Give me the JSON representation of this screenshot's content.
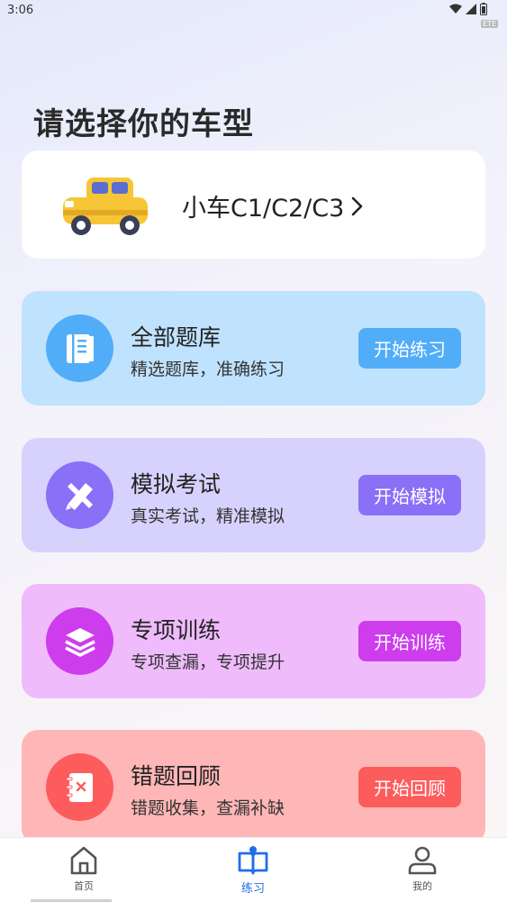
{
  "status_bar": {
    "time": "3:06",
    "tag": "ETE",
    "icons": [
      "wifi-icon",
      "signal-icon",
      "battery-icon"
    ]
  },
  "page_title": "请选择你的车型",
  "car_selector": {
    "label": "小车C1/C2/C3",
    "icon": "car-icon",
    "chevron": "chevron-right-icon"
  },
  "features": [
    {
      "title": "全部题库",
      "subtitle": "精选题库，准确练习",
      "button": "开始练习",
      "icon": "question-bank-icon",
      "card_color": "#bfe2fe",
      "accent_color": "#52adf8"
    },
    {
      "title": "模拟考试",
      "subtitle": "真实考试，精准模拟",
      "button": "开始模拟",
      "icon": "pencil-ruler-icon",
      "card_color": "#d7d2fd",
      "accent_color": "#8a6ff7"
    },
    {
      "title": "专项训练",
      "subtitle": "专项查漏，专项提升",
      "button": "开始训练",
      "icon": "layers-icon",
      "card_color": "#efbbfb",
      "accent_color": "#cd3ced"
    },
    {
      "title": "错题回顾",
      "subtitle": "错题收集，查漏补缺",
      "button": "开始回顾",
      "icon": "wrong-notebook-icon",
      "card_color": "#ffb6b6",
      "accent_color": "#fd5c5c"
    }
  ],
  "tab_bar": {
    "items": [
      {
        "label": "首页",
        "icon": "home-icon",
        "active": false
      },
      {
        "label": "练习",
        "icon": "book-icon",
        "active": true
      },
      {
        "label": "我的",
        "icon": "user-icon",
        "active": false
      }
    ],
    "active_color": "#1f6fe8"
  }
}
